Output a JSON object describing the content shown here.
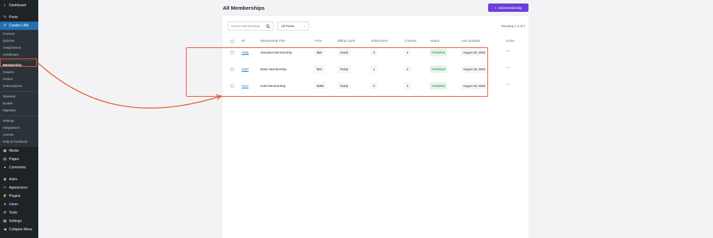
{
  "sidebar": {
    "top_items": [
      {
        "icon": "dashboard-icon",
        "label": "Dashboard"
      },
      {
        "icon": "pin-icon",
        "label": "Posts"
      }
    ],
    "active_item": {
      "icon": "creator-lms-icon",
      "label": "Creator LMS"
    },
    "submenu_group1": [
      "Courses",
      "Quizzes",
      "Assignments",
      "Certificates"
    ],
    "submenu_group2": [
      "Membership",
      "Coupon",
      "Orders",
      "Subscriptions"
    ],
    "submenu_group3": [
      "Students",
      "Emails",
      "Migration"
    ],
    "submenu_group4": [
      "Settings",
      "Integrations",
      "License",
      "Help & Feedback"
    ],
    "bottom_items": [
      {
        "icon": "media-icon",
        "label": "Media"
      },
      {
        "icon": "pages-icon",
        "label": "Pages"
      },
      {
        "icon": "comments-icon",
        "label": "Comments"
      },
      {
        "icon": "astra-icon",
        "label": "Astra"
      },
      {
        "icon": "appearance-icon",
        "label": "Appearance"
      },
      {
        "icon": "plugins-icon",
        "label": "Plugins"
      },
      {
        "icon": "users-icon",
        "label": "Users"
      },
      {
        "icon": "tools-icon",
        "label": "Tools"
      },
      {
        "icon": "settings-icon",
        "label": "Settings"
      },
      {
        "icon": "collapse-icon",
        "label": "Collapse Menu"
      }
    ]
  },
  "page": {
    "title": "All Memberships",
    "add_button": "Add Membership",
    "add_button_icon": "+"
  },
  "toolbar": {
    "search_placeholder": "Search Membership",
    "filter_value": "All Times",
    "showing": "Showing 1-3 of 3"
  },
  "table": {
    "headers": {
      "id": "ID",
      "plan": "Membership Plan",
      "price": "Price",
      "billing": "Billing Cycle",
      "subscribers": "Subscribers",
      "courses": "Courses",
      "status": "Status",
      "updated": "Last Updated",
      "action": "Action"
    },
    "rows": [
      {
        "id": "#365",
        "plan": "Standard Membership",
        "price": "$50",
        "billing": "Yearly",
        "subscribers": "3",
        "courses": "4",
        "status": "Published",
        "updated": "August 28, 2020",
        "action": "···"
      },
      {
        "id": "#367",
        "plan": "Basic Membership",
        "price": "$10",
        "billing": "Yearly",
        "subscribers": "1",
        "courses": "2",
        "status": "Published",
        "updated": "August 28, 2020",
        "action": "···"
      },
      {
        "id": "#117",
        "plan": "Gold Membership",
        "price": "$499",
        "billing": "Yearly",
        "subscribers": "0",
        "courses": "3",
        "status": "Published",
        "updated": "August 29, 2020",
        "action": "···"
      }
    ]
  },
  "colors": {
    "sidebar_bg": "#1d2327",
    "active_menu": "#2271b1",
    "primary_button": "#6b3fd9",
    "status_published": "#1a7f43",
    "annotation": "#e8542c"
  }
}
